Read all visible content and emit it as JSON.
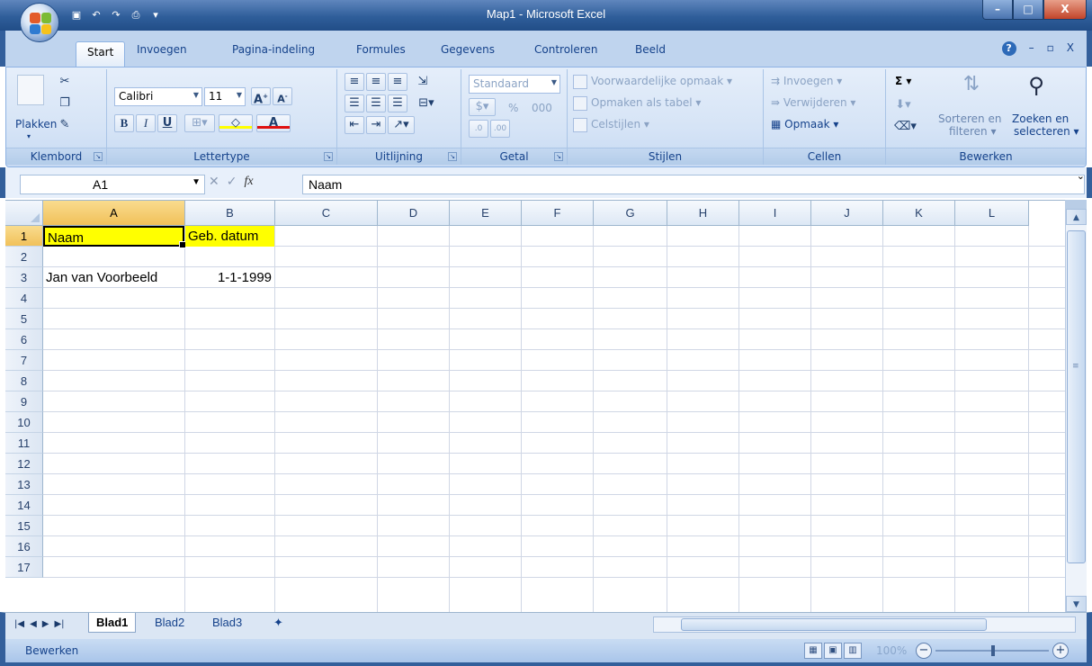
{
  "window": {
    "title": "Map1 - Microsoft Excel",
    "controls": {
      "minimize": "–",
      "maximize": "□",
      "close": "X"
    }
  },
  "qat": [
    "save-icon",
    "undo-icon",
    "redo-icon",
    "print-preview-icon",
    "customize-icon"
  ],
  "tabs": [
    {
      "label": "Start",
      "active": true
    },
    {
      "label": "Invoegen"
    },
    {
      "label": "Pagina-indeling"
    },
    {
      "label": "Formules"
    },
    {
      "label": "Gegevens"
    },
    {
      "label": "Controleren"
    },
    {
      "label": "Beeld"
    }
  ],
  "ribbon": {
    "clipboard": {
      "label": "Klembord",
      "paste": "Plakken"
    },
    "font": {
      "label": "Lettertype",
      "name": "Calibri",
      "size": "11",
      "bold": "B",
      "italic": "I",
      "underline": "U"
    },
    "alignment": {
      "label": "Uitlijning"
    },
    "number": {
      "label": "Getal",
      "format": "Standaard",
      "percent": "%",
      "thousands": "000"
    },
    "styles": {
      "label": "Stijlen",
      "conditional": "Voorwaardelijke opmaak",
      "table": "Opmaken als tabel",
      "cell_styles": "Celstijlen"
    },
    "cells": {
      "label": "Cellen",
      "insert": "Invoegen",
      "delete": "Verwijderen",
      "format": "Opmaak"
    },
    "editing": {
      "label": "Bewerken",
      "sum": "Σ",
      "sort_line1": "Sorteren en",
      "sort_line2": "filteren",
      "find_line1": "Zoeken en",
      "find_line2": "selecteren"
    }
  },
  "formula_bar": {
    "name_box": "A1",
    "fx": "fx",
    "value": "Naam"
  },
  "columns": [
    "A",
    "B",
    "C",
    "D",
    "E",
    "F",
    "G",
    "H",
    "I",
    "J",
    "K",
    "L"
  ],
  "rows": [
    "1",
    "2",
    "3",
    "4",
    "5",
    "6",
    "7",
    "8",
    "9",
    "10",
    "11",
    "12",
    "13",
    "14",
    "15",
    "16",
    "17"
  ],
  "cells": {
    "A1": "Naam",
    "B1": "Geb. datum",
    "A3": "Jan van Voorbeeld",
    "B3": "1-1-1999"
  },
  "sheets": [
    {
      "label": "Blad1",
      "active": true
    },
    {
      "label": "Blad2"
    },
    {
      "label": "Blad3"
    }
  ],
  "status": {
    "mode": "Bewerken",
    "zoom": "100%"
  },
  "colors": {
    "highlight": "#ffff00",
    "frame": "#335f9b"
  }
}
